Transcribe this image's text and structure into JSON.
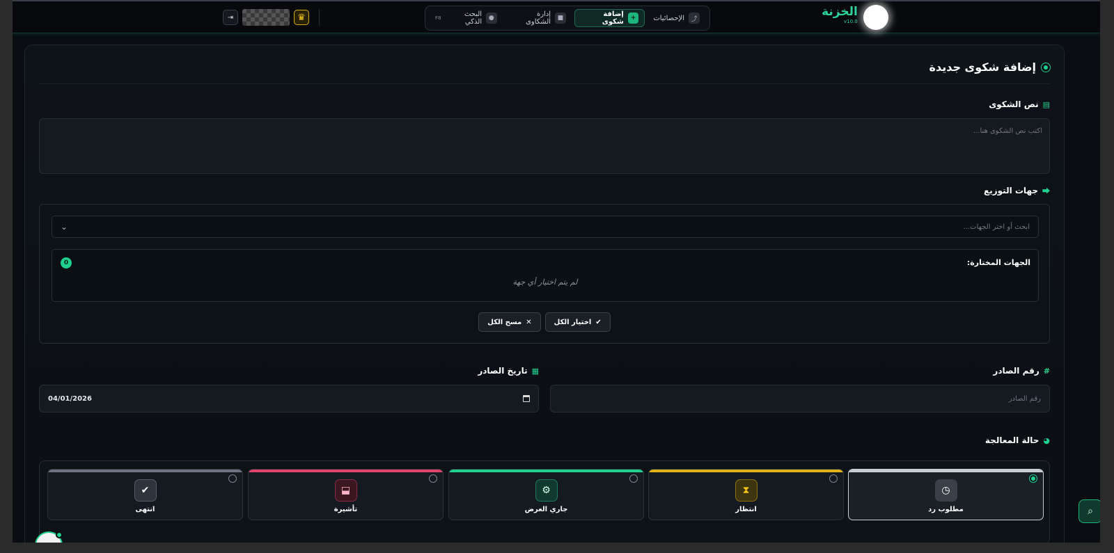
{
  "header": {
    "brand_title": "الخزنة",
    "brand_version": "v10.0",
    "nav_tabs": [
      {
        "label": "الإحصائيات",
        "icon": "chart-icon"
      },
      {
        "label": "إضافة شكوى",
        "icon": "plus-circle-icon",
        "active": true
      },
      {
        "label": "إدارة الشكاوى",
        "icon": "trash-icon"
      },
      {
        "label": "البحث الذكي",
        "icon": "robot-icon",
        "badge": "F8"
      }
    ]
  },
  "form": {
    "title": "إضافة شكوى جديدة",
    "complaint_text": {
      "label": "نص الشكوى",
      "placeholder": "اكتب نص الشكوى هنا..."
    },
    "distribution": {
      "label": "جهات التوزيع",
      "search_placeholder": "ابحث أو اختر الجهات...",
      "selected_label": "الجهات المختارة:",
      "selected_count": "0",
      "empty_message": "لم يتم اختيار أي جهة",
      "select_all": "اختيار الكل",
      "clear_all": "مسح الكل"
    },
    "outgoing_number": {
      "label": "رقم الصادر",
      "placeholder": "رقم الصادر"
    },
    "outgoing_date": {
      "label": "تاريخ الصادر",
      "value": "04/01/2026"
    },
    "processing_status": {
      "label": "حالة المعالجة",
      "options": [
        {
          "label": "مطلوب رد",
          "icon": "clock-icon",
          "color": "#c9ced4",
          "selected": true
        },
        {
          "label": "انتظار",
          "icon": "hourglass-icon",
          "color": "#e2b21a"
        },
        {
          "label": "جاري العرض",
          "icon": "gears-icon",
          "color": "#1fd08e"
        },
        {
          "label": "تأشيرة",
          "icon": "stamp-icon",
          "color": "#e0436b"
        },
        {
          "label": "انتهى",
          "icon": "check-circle-icon",
          "color": "#6b7480"
        }
      ]
    }
  },
  "colors": {
    "accent": "#1fd08e",
    "background": "#0a0d12"
  }
}
